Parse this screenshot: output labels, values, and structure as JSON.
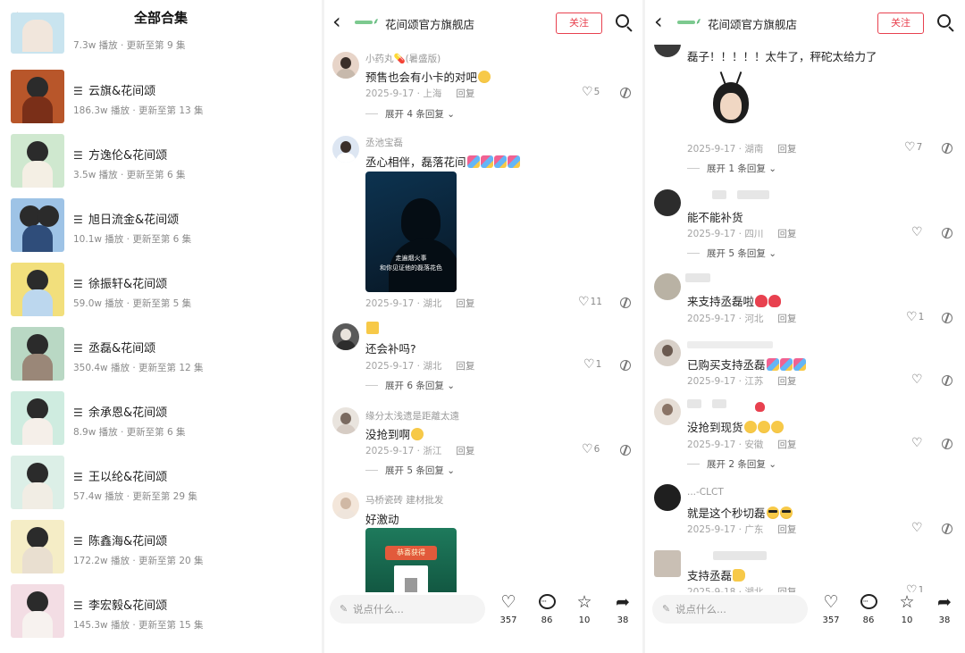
{
  "left": {
    "title": "全部合集",
    "items": [
      {
        "title": "",
        "meta": "7.3w 播放 · 更新至第 9 集",
        "color": "#c9e4ef"
      },
      {
        "title": "云旗&花间颂",
        "meta": "186.3w 播放 · 更新至第 13 集",
        "color": "#b8562a"
      },
      {
        "title": "方逸伦&花间颂",
        "meta": "3.5w 播放 · 更新至第 6 集",
        "color": "#cfe8cf"
      },
      {
        "title": "旭日流金&花间颂",
        "meta": "10.1w 播放 · 更新至第 6 集",
        "color": "#9ec3e6"
      },
      {
        "title": "徐振轩&花间颂",
        "meta": "59.0w 播放 · 更新至第 5 集",
        "color": "#f2df7c"
      },
      {
        "title": "丞磊&花间颂",
        "meta": "350.4w 播放 · 更新至第 12 集",
        "color": "#b9d8c4"
      },
      {
        "title": "余承恩&花间颂",
        "meta": "8.9w 播放 · 更新至第 6 集",
        "color": "#cfece0"
      },
      {
        "title": "王以纶&花间颂",
        "meta": "57.4w 播放 · 更新至第 29 集",
        "color": "#dcefe7"
      },
      {
        "title": "陈鑫海&花间颂",
        "meta": "172.2w 播放 · 更新至第 20 集",
        "color": "#f5edc6"
      },
      {
        "title": "李宏毅&花间颂",
        "meta": "145.3w 播放 · 更新至第 15 集",
        "color": "#f3dde4"
      }
    ]
  },
  "shop": {
    "name": "花间颂官方旗舰店",
    "follow": "关注"
  },
  "middle": {
    "comments": [
      {
        "user": "小药丸💊(暑盛版)",
        "text": "预售也会有小卡的对吧",
        "meta": "2025-9-17 · 上海",
        "reply": "回复",
        "likes": "5",
        "expand": "展开 4 条回复"
      },
      {
        "user": "丞池宝磊",
        "text": "丞心相伴，磊落花间",
        "meta": "2025-9-17 · 湖北",
        "reply": "回复",
        "likes": "11",
        "image_caption_1": "走遍烟火事",
        "image_caption_2": "和你见证他的磊落花色"
      },
      {
        "user": "",
        "text": "还会补吗?",
        "meta": "2025-9-17 · 湖北",
        "reply": "回复",
        "likes": "1",
        "expand": "展开 6 条回复"
      },
      {
        "user": "缘分太浅遗是距離太遠",
        "text": "没抢到啊",
        "meta": "2025-9-17 · 浙江",
        "reply": "回复",
        "likes": "6",
        "expand": "展开 5 条回复"
      },
      {
        "user": "马桥瓷砖 建材批发",
        "text": "好激动",
        "image_banner": "恭喜获得"
      }
    ],
    "input_placeholder": "说点什么...",
    "actions": {
      "like": "357",
      "comment": "86",
      "star": "10",
      "share": "38"
    }
  },
  "right": {
    "comments": [
      {
        "text": "磊子！！！！！太牛了，秤砣太给力了",
        "meta": "2025-9-17 · 湖南",
        "reply": "回复",
        "likes": "7",
        "expand": "展开 1 条回复"
      },
      {
        "text": "能不能补货",
        "meta": "2025-9-17 · 四川",
        "reply": "回复",
        "expand": "展开 5 条回复"
      },
      {
        "text": "来支持丞磊啦",
        "meta": "2025-9-17 · 河北",
        "reply": "回复",
        "likes": "1"
      },
      {
        "text": "已购买支持丞磊",
        "meta": "2025-9-17 · 江苏",
        "reply": "回复"
      },
      {
        "text": "没抢到现货",
        "meta": "2025-9-17 · 安徽",
        "reply": "回复",
        "expand": "展开 2 条回复"
      },
      {
        "user": "...-CLCT",
        "text": "就是这个秒切磊",
        "meta": "2025-9-17 · 广东",
        "reply": "回复"
      },
      {
        "text": "支持丞磊",
        "meta": "2025-9-18 · 湖北",
        "reply": "回复",
        "likes": "1"
      }
    ],
    "input_placeholder": "说点什么...",
    "actions": {
      "like": "357",
      "comment": "86",
      "star": "10",
      "share": "38"
    }
  },
  "colors": {
    "accent": "#e8414f",
    "muted": "#9a9a9a"
  }
}
